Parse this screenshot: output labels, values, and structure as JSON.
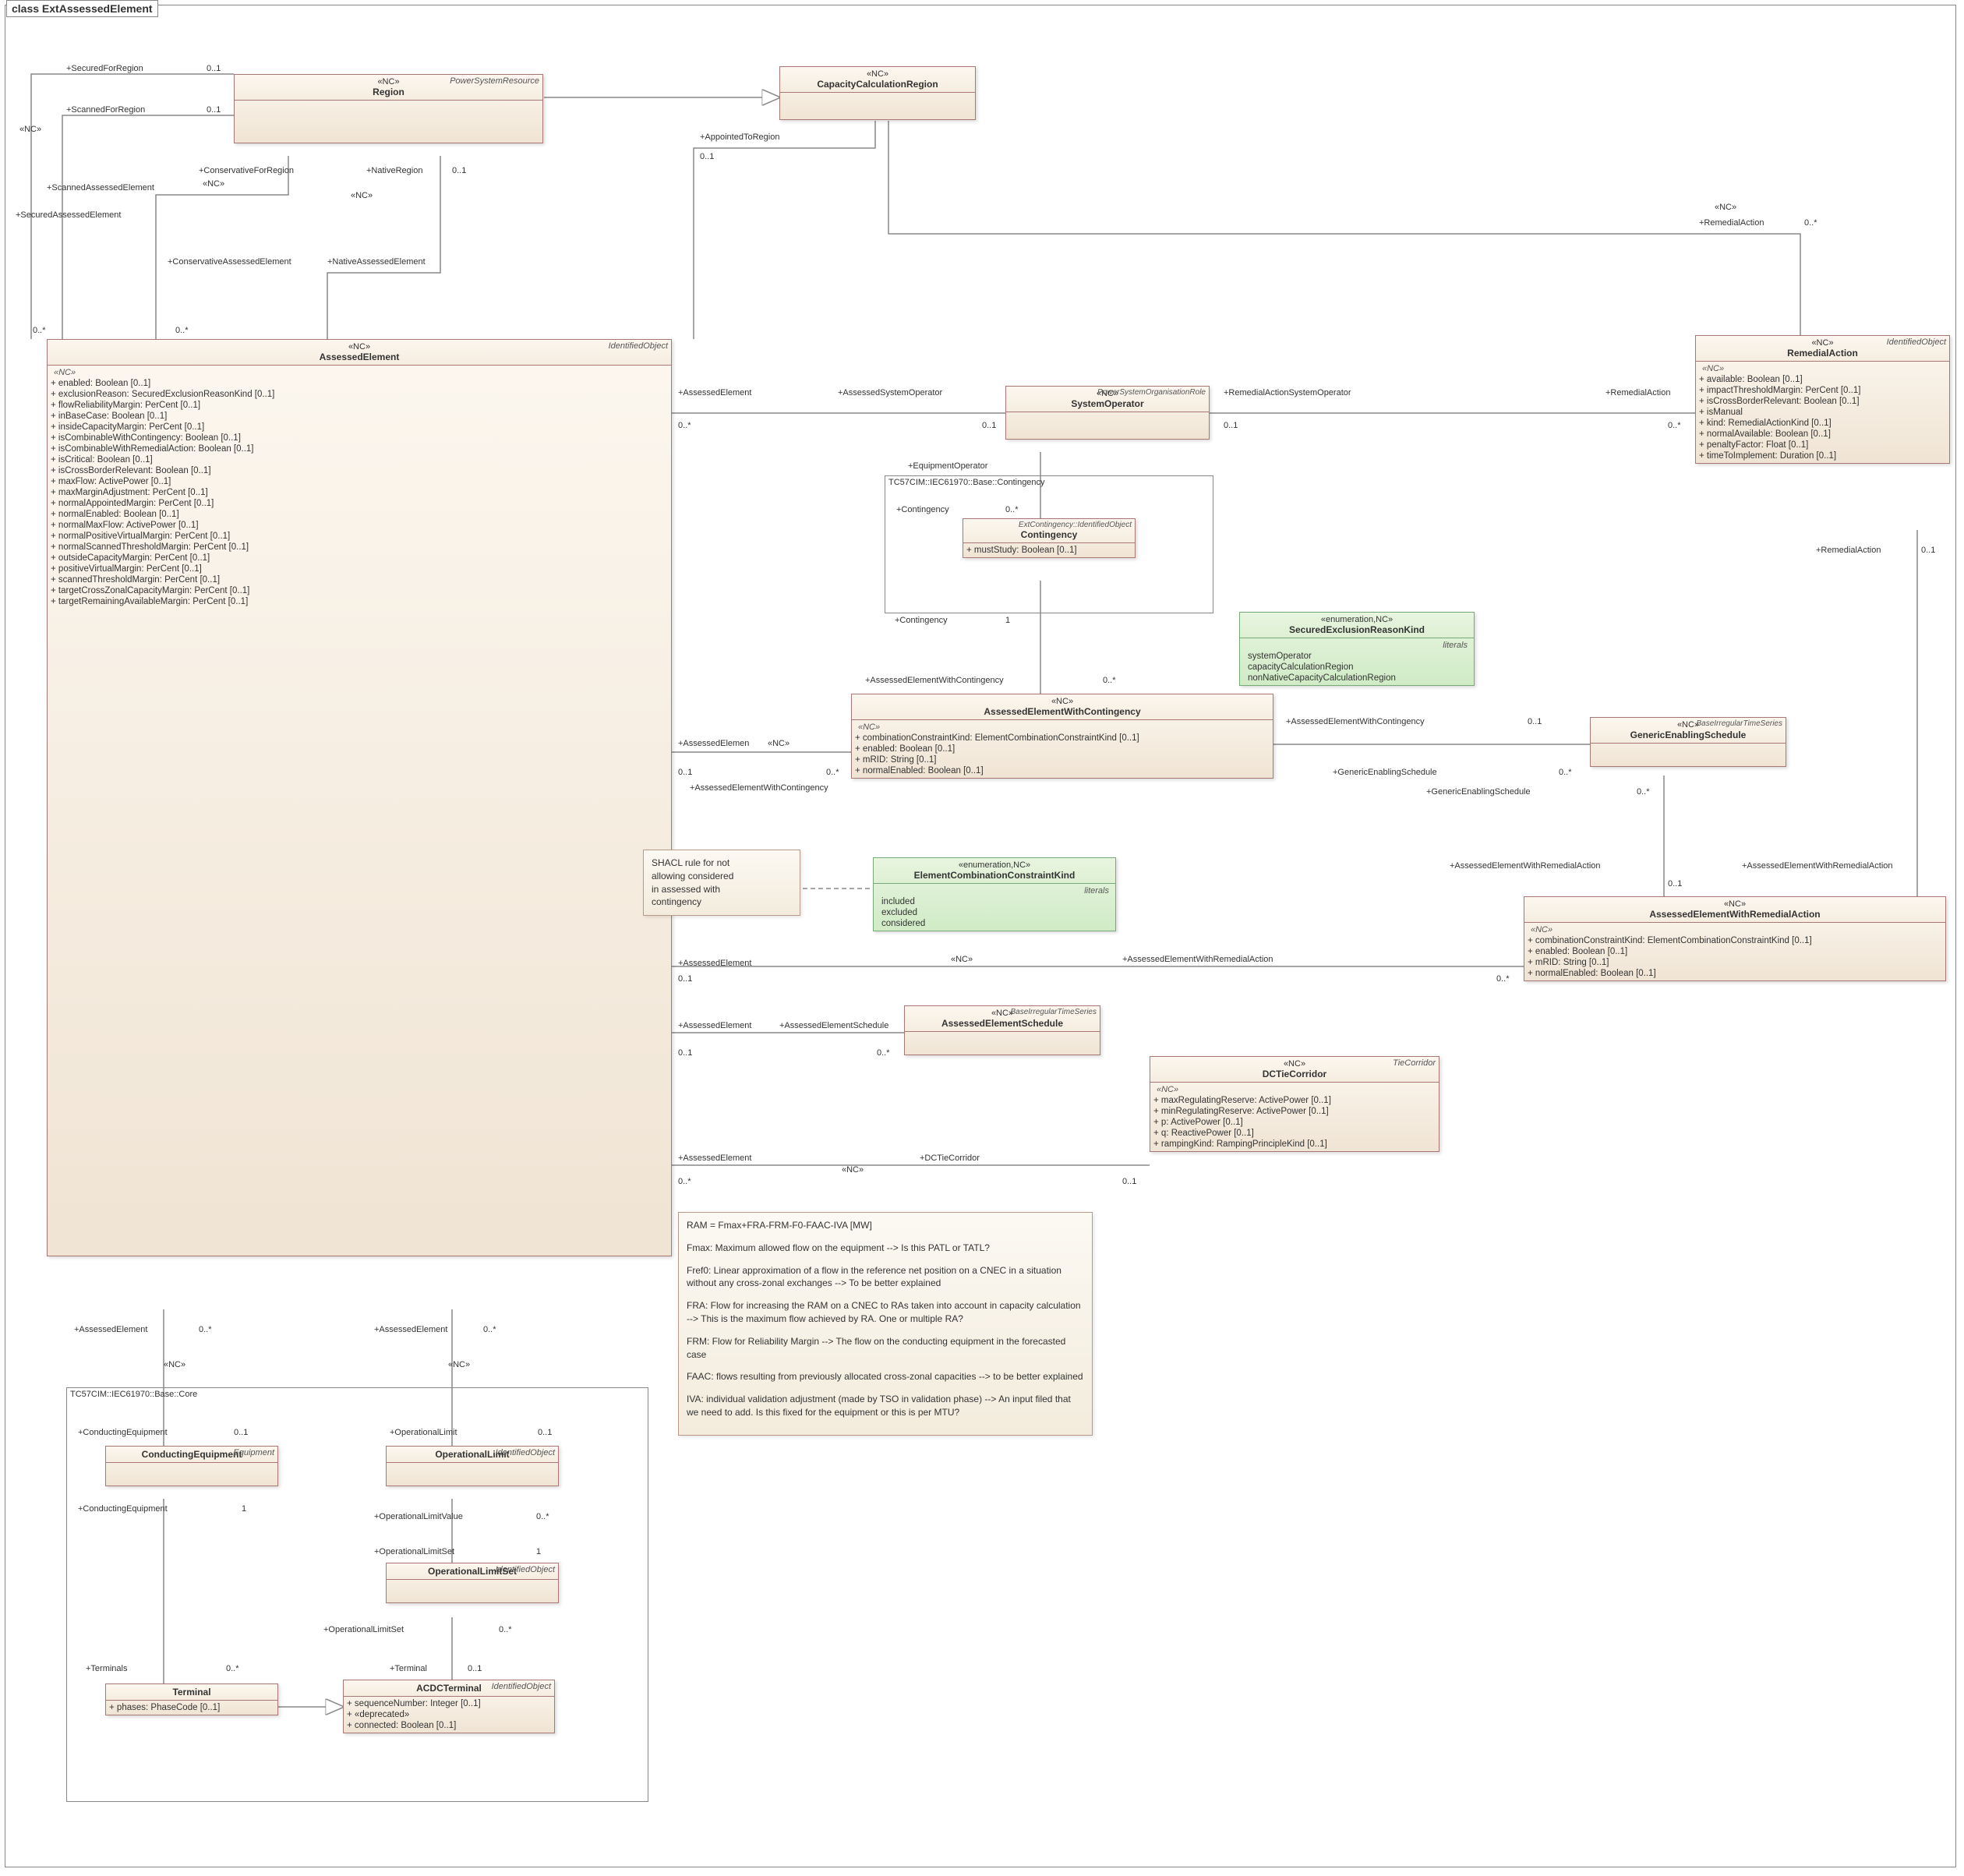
{
  "title": "class ExtAssessedElement",
  "classes": {
    "Region": {
      "name": "Region",
      "stereo": "«NC»",
      "parent": "PowerSystemResource"
    },
    "CapacityCalculationRegion": {
      "name": "CapacityCalculationRegion",
      "stereo": "«NC»"
    },
    "AssessedElement": {
      "name": "AssessedElement",
      "stereo": "«NC»",
      "parent": "IdentifiedObject",
      "sectionTitle": "«NC»",
      "attrs": [
        "enabled: Boolean [0..1]",
        "exclusionReason: SecuredExclusionReasonKind [0..1]",
        "flowReliabilityMargin: PerCent [0..1]",
        "inBaseCase: Boolean [0..1]",
        "insideCapacityMargin: PerCent [0..1]",
        "isCombinableWithContingency: Boolean [0..1]",
        "isCombinableWithRemedialAction: Boolean [0..1]",
        "isCritical: Boolean [0..1]",
        "isCrossBorderRelevant: Boolean [0..1]",
        "maxFlow: ActivePower [0..1]",
        "maxMarginAdjustment: PerCent [0..1]",
        "normalAppointedMargin: PerCent [0..1]",
        "normalEnabled: Boolean [0..1]",
        "normalMaxFlow: ActivePower [0..1]",
        "normalPositiveVirtualMargin: PerCent [0..1]",
        "normalScannedThresholdMargin: PerCent [0..1]",
        "outsideCapacityMargin: PerCent [0..1]",
        "positiveVirtualMargin: PerCent [0..1]",
        "scannedThresholdMargin: PerCent [0..1]",
        "targetCrossZonalCapacityMargin: PerCent [0..1]",
        "targetRemainingAvailableMargin: PerCent [0..1]"
      ]
    },
    "SystemOperator": {
      "name": "SystemOperator",
      "stereo": "«NC»",
      "parent": "PowerSystemOrganisationRole"
    },
    "RemedialAction": {
      "name": "RemedialAction",
      "stereo": "«NC»",
      "parent": "IdentifiedObject",
      "sectionTitle": "«NC»",
      "attrs": [
        "available: Boolean [0..1]",
        "impactThresholdMargin: PerCent [0..1]",
        "isCrossBorderRelevant: Boolean [0..1]",
        "isManual",
        "kind: RemedialActionKind [0..1]",
        "normalAvailable: Boolean [0..1]",
        "penaltyFactor: Float [0..1]",
        "timeToImplement: Duration [0..1]"
      ]
    },
    "ContingencyPkg": "TC57CIM::IEC61970::Base::Contingency",
    "Contingency": {
      "name": "Contingency",
      "parent2": "ExtContingency::IdentifiedObject",
      "attrs": [
        "mustStudy: Boolean [0..1]"
      ]
    },
    "SecuredExclusionReasonKind": {
      "name": "SecuredExclusionReasonKind",
      "stereo": "«enumeration,NC»",
      "section": "literals",
      "literals": [
        "systemOperator",
        "capacityCalculationRegion",
        "nonNativeCapacityCalculationRegion"
      ]
    },
    "AssessedElementWithContingency": {
      "name": "AssessedElementWithContingency",
      "stereo": "«NC»",
      "sectionTitle": "«NC»",
      "attrs": [
        "combinationConstraintKind: ElementCombinationConstraintKind [0..1]",
        "enabled: Boolean [0..1]",
        "mRID: String [0..1]",
        "normalEnabled: Boolean [0..1]"
      ]
    },
    "GenericEnablingSchedule": {
      "name": "GenericEnablingSchedule",
      "stereo": "«NC»",
      "parent": "BaseIrregularTimeSeries"
    },
    "ElementCombinationConstraintKind": {
      "name": "ElementCombinationConstraintKind",
      "stereo": "«enumeration,NC»",
      "section": "literals",
      "literals": [
        "included",
        "excluded",
        "considered"
      ]
    },
    "AssessedElementWithRemedialAction": {
      "name": "AssessedElementWithRemedialAction",
      "stereo": "«NC»",
      "sectionTitle": "«NC»",
      "attrs": [
        "combinationConstraintKind: ElementCombinationConstraintKind [0..1]",
        "enabled: Boolean [0..1]",
        "mRID: String [0..1]",
        "normalEnabled: Boolean [0..1]"
      ]
    },
    "AssessedElementSchedule": {
      "name": "AssessedElementSchedule",
      "stereo": "«NC»",
      "parent": "BaseIrregularTimeSeries"
    },
    "DCTieCorridor": {
      "name": "DCTieCorridor",
      "stereo": "«NC»",
      "parent": "TieCorridor",
      "sectionTitle": "«NC»",
      "attrs": [
        "maxRegulatingReserve: ActivePower [0..1]",
        "minRegulatingReserve: ActivePower [0..1]",
        "p: ActivePower [0..1]",
        "q: ReactivePower [0..1]",
        "rampingKind: RampingPrincipleKind [0..1]"
      ]
    },
    "CorePkg": "TC57CIM::IEC61970::Base::Core",
    "ConductingEquipment": {
      "name": "ConductingEquipment",
      "parent": "Equipment"
    },
    "OperationalLimit": {
      "name": "OperationalLimit",
      "parent": "IdentifiedObject"
    },
    "OperationalLimitSet": {
      "name": "OperationalLimitSet",
      "parent": "IdentifiedObject"
    },
    "Terminal": {
      "name": "Terminal",
      "attrs": [
        "phases: PhaseCode [0..1]"
      ]
    },
    "ACDCTerminal": {
      "name": "ACDCTerminal",
      "parent": "IdentifiedObject",
      "attrs": [
        "sequenceNumber: Integer [0..1]",
        "«deprecated»",
        "connected: Boolean [0..1]"
      ]
    }
  },
  "note1": {
    "lines": [
      "SHACL rule for not",
      "allowing considered",
      "in assessed with",
      "contingency"
    ]
  },
  "note2": {
    "paras": [
      "RAM = Fmax+FRA-FRM-F0-FAAC-IVA [MW]",
      "Fmax: Maximum allowed flow on the equipment --> Is this PATL or TATL?",
      "Fref0: Linear approximation of a flow in the reference net position on a CNEC in a situation without any cross-zonal exchanges --> To be better explained",
      "FRA: Flow for increasing the RAM on a CNEC to RAs taken into account in capacity calculation -->  This is the maximum flow achieved by RA. One or multiple RA?",
      "FRM: Flow for Reliability Margin --> The flow on the conducting equipment in the forecasted case",
      "FAAC: flows resulting from previously allocated cross-zonal capacities --> to be better explained",
      "IVA: individual validation adjustment (made by TSO in validation phase) --> An input filed that we need to add. Is this fixed for the equipment or this is per MTU?"
    ]
  },
  "labels": {
    "SecuredForRegion": "+SecuredForRegion",
    "m01": "0..1",
    "ScannedForRegion": "+ScannedForRegion",
    "ConservativeForRegion": "+ConservativeForRegion",
    "NativeRegion": "+NativeRegion",
    "ScannedAssessedElement": "+ScannedAssessedElement",
    "SecuredAssessedElement": "+SecuredAssessedElement",
    "ConservativeAssessedElement": "+ConservativeAssessedElement",
    "NativeAssessedElement": "+NativeAssessedElement",
    "m0s": "0..*",
    "nc": "«NC»",
    "AppointedToRegion": "+AppointedToRegion",
    "RemedialActionTop": "+RemedialAction",
    "AssessedElement": "+AssessedElement",
    "AssessedSystemOperator": "+AssessedSystemOperator",
    "RemedialActionSystemOperator": "+RemedialActionSystemOperator",
    "EquipmentOperator": "+EquipmentOperator",
    "Contingency": "+Contingency",
    "AssessedElemen": "+AssessedElemen",
    "AssessedElementWithContingency": "+AssessedElementWithContingency",
    "GenericEnablingSchedule": "+GenericEnablingSchedule",
    "AssessedElementWithRemedialAction": "+AssessedElementWithRemedialAction",
    "AssessedElementSchedule": "+AssessedElementSchedule",
    "DCTieCorridor": "+DCTieCorridor",
    "ConductingEquipment": "+ConductingEquipment",
    "OperationalLimit": "+OperationalLimit",
    "OperationalLimitValue": "+OperationalLimitValue",
    "OperationalLimitSet": "+OperationalLimitSet",
    "Terminals": "+Terminals",
    "Terminal": "+Terminal",
    "m1": "1",
    "m01a": "0..1"
  }
}
